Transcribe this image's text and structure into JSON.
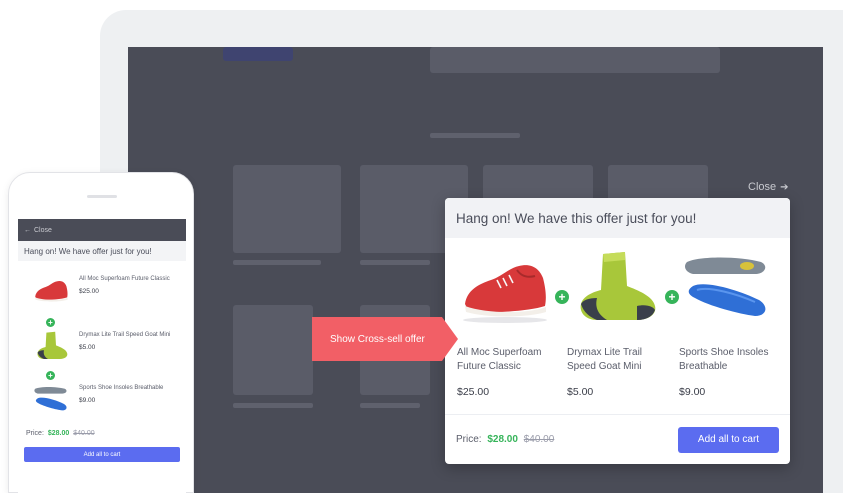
{
  "desktop": {
    "close_label": "Close",
    "close_icon": "arrow-right-icon"
  },
  "modal": {
    "title": "Hang on! We have this offer just for you!",
    "products": [
      {
        "name": "All Moc Superfoam Future Classic",
        "price": "$25.00",
        "image": "red-sneaker"
      },
      {
        "name": "Drymax Lite Trail Speed Goat Mini",
        "price": "$5.00",
        "image": "green-sock"
      },
      {
        "name": "Sports Shoe Insoles Breathable",
        "price": "$9.00",
        "image": "blue-insoles"
      }
    ],
    "plus_symbol": "+",
    "price_label": "Price:",
    "price_new": "$28.00",
    "price_old": "$40.00",
    "cart_button": "Add all to cart"
  },
  "callout": {
    "label": "Show Cross-sell offer"
  },
  "phone": {
    "back_label": "Close",
    "back_icon": "arrow-left-icon",
    "title": "Hang on! We have offer just for you!",
    "products": [
      {
        "name": "All Moc Superfoam Future Classic",
        "price": "$25.00"
      },
      {
        "name": "Drymax Lite Trail Speed Goat Mini",
        "price": "$5.00"
      },
      {
        "name": "Sports Shoe Insoles Breathable",
        "price": "$9.00"
      }
    ],
    "plus_symbol": "+",
    "price_label": "Price:",
    "price_new": "$28.00",
    "price_old": "$40.00",
    "cart_button": "Add all to cart"
  },
  "colors": {
    "accent": "#5b6cf0",
    "success": "#36b45a",
    "callout": "#f25f66",
    "overlay": "#4a4c57"
  }
}
